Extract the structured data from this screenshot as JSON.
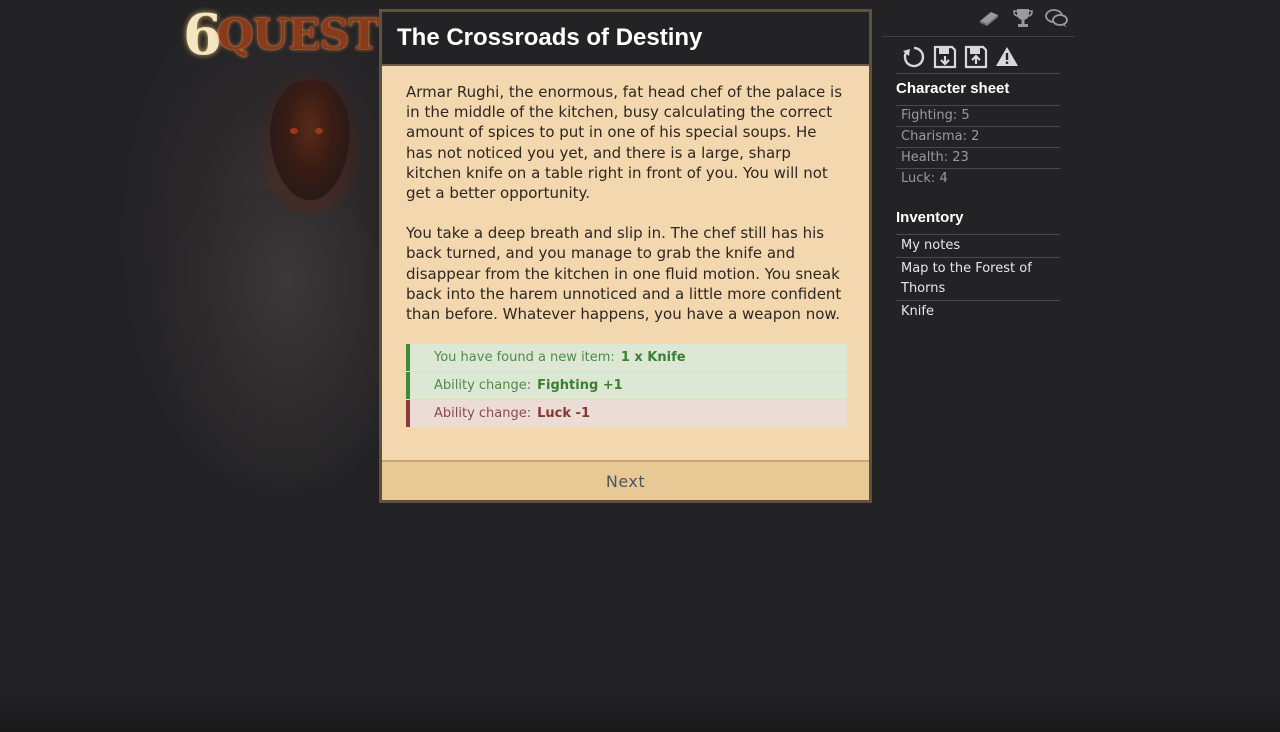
{
  "logo": {
    "mark": "6",
    "word": "QUEST"
  },
  "story": {
    "title": "The Crossroads of Destiny",
    "paragraphs": [
      "Armar Rughi, the enormous, fat head chef of the palace is in the middle of the kitchen, busy calculating the correct amount of spices to put in one of his special soups. He has not noticed you yet, and there is a large, sharp kitchen knife on a table right in front of you. You will not get a better opportunity.",
      "You take a deep breath and slip in. The chef still has his back turned, and you manage to grab the knife and disappear from the kitchen in one fluid motion. You sneak back into the harem unnoticed and a little more confident than before. Whatever happens, you have a weapon now."
    ],
    "notices": [
      {
        "type": "good",
        "label": "You have found a new item:",
        "value": "1 x Knife"
      },
      {
        "type": "good",
        "label": "Ability change:",
        "value": "Fighting +1"
      },
      {
        "type": "bad",
        "label": "Ability change:",
        "value": "Luck -1"
      }
    ],
    "next_label": "Next"
  },
  "sidebar": {
    "top_icons": [
      "book-icon",
      "trophy-icon",
      "chat-bubbles-icon"
    ],
    "action_icons": [
      "restart-icon",
      "save-download-icon",
      "save-upload-icon",
      "warning-icon"
    ],
    "character_title": "Character sheet",
    "stats": [
      "Fighting: 5",
      "Charisma: 2",
      "Health: 23",
      "Luck: 4"
    ],
    "inventory_title": "Inventory",
    "inventory": [
      "My notes",
      "Map to the Forest of Thorns",
      "Knife"
    ]
  },
  "colors": {
    "background": "#232325",
    "panel": "#f3d7ae",
    "good": "#3f8a3a",
    "bad": "#8a3a3a"
  }
}
